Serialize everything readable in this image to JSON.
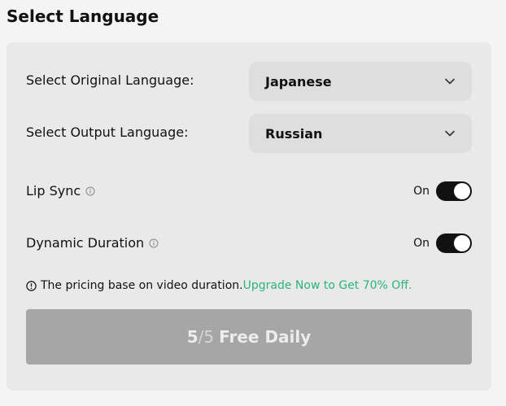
{
  "page": {
    "title": "Select Language"
  },
  "original_language": {
    "label": "Select Original Language:",
    "value": "Japanese",
    "icon": "chevron-down-icon"
  },
  "output_language": {
    "label": "Select Output Language:",
    "value": "Russian",
    "icon": "chevron-down-icon"
  },
  "lip_sync": {
    "label": "Lip Sync",
    "state_label": "On",
    "enabled": true,
    "icon": "info-icon"
  },
  "dynamic_duration": {
    "label": "Dynamic Duration",
    "state_label": "On",
    "enabled": true,
    "icon": "info-icon"
  },
  "pricing": {
    "note": "The pricing base on video duration.",
    "upgrade_link": "Upgrade Now to Get 70% Off.",
    "icon": "info-icon"
  },
  "submit": {
    "used": "5",
    "separator": "/",
    "total": "5",
    "label": "Free Daily"
  },
  "colors": {
    "accent_link": "#2bb57a",
    "toggle_on": "#111111",
    "button_disabled": "#a6a6a6",
    "panel_bg": "#e9e9e9",
    "select_bg": "#dedede"
  }
}
